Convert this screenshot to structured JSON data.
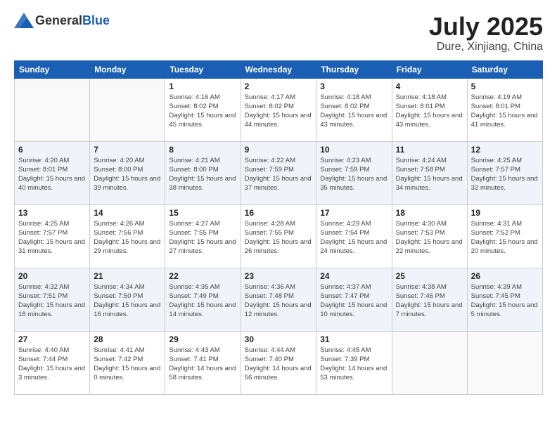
{
  "header": {
    "logo": {
      "general": "General",
      "blue": "Blue"
    },
    "title": "July 2025",
    "location": "Dure, Xinjiang, China"
  },
  "weekdays": [
    "Sunday",
    "Monday",
    "Tuesday",
    "Wednesday",
    "Thursday",
    "Friday",
    "Saturday"
  ],
  "weeks": [
    [
      {
        "day": "",
        "info": ""
      },
      {
        "day": "",
        "info": ""
      },
      {
        "day": "1",
        "info": "Sunrise: 4:16 AM\nSunset: 8:02 PM\nDaylight: 15 hours and 45 minutes."
      },
      {
        "day": "2",
        "info": "Sunrise: 4:17 AM\nSunset: 8:02 PM\nDaylight: 15 hours and 44 minutes."
      },
      {
        "day": "3",
        "info": "Sunrise: 4:18 AM\nSunset: 8:02 PM\nDaylight: 15 hours and 43 minutes."
      },
      {
        "day": "4",
        "info": "Sunrise: 4:18 AM\nSunset: 8:01 PM\nDaylight: 15 hours and 43 minutes."
      },
      {
        "day": "5",
        "info": "Sunrise: 4:19 AM\nSunset: 8:01 PM\nDaylight: 15 hours and 41 minutes."
      }
    ],
    [
      {
        "day": "6",
        "info": "Sunrise: 4:20 AM\nSunset: 8:01 PM\nDaylight: 15 hours and 40 minutes."
      },
      {
        "day": "7",
        "info": "Sunrise: 4:20 AM\nSunset: 8:00 PM\nDaylight: 15 hours and 39 minutes."
      },
      {
        "day": "8",
        "info": "Sunrise: 4:21 AM\nSunset: 8:00 PM\nDaylight: 15 hours and 38 minutes."
      },
      {
        "day": "9",
        "info": "Sunrise: 4:22 AM\nSunset: 7:59 PM\nDaylight: 15 hours and 37 minutes."
      },
      {
        "day": "10",
        "info": "Sunrise: 4:23 AM\nSunset: 7:59 PM\nDaylight: 15 hours and 35 minutes."
      },
      {
        "day": "11",
        "info": "Sunrise: 4:24 AM\nSunset: 7:58 PM\nDaylight: 15 hours and 34 minutes."
      },
      {
        "day": "12",
        "info": "Sunrise: 4:25 AM\nSunset: 7:57 PM\nDaylight: 15 hours and 32 minutes."
      }
    ],
    [
      {
        "day": "13",
        "info": "Sunrise: 4:25 AM\nSunset: 7:57 PM\nDaylight: 15 hours and 31 minutes."
      },
      {
        "day": "14",
        "info": "Sunrise: 4:26 AM\nSunset: 7:56 PM\nDaylight: 15 hours and 29 minutes."
      },
      {
        "day": "15",
        "info": "Sunrise: 4:27 AM\nSunset: 7:55 PM\nDaylight: 15 hours and 27 minutes."
      },
      {
        "day": "16",
        "info": "Sunrise: 4:28 AM\nSunset: 7:55 PM\nDaylight: 15 hours and 26 minutes."
      },
      {
        "day": "17",
        "info": "Sunrise: 4:29 AM\nSunset: 7:54 PM\nDaylight: 15 hours and 24 minutes."
      },
      {
        "day": "18",
        "info": "Sunrise: 4:30 AM\nSunset: 7:53 PM\nDaylight: 15 hours and 22 minutes."
      },
      {
        "day": "19",
        "info": "Sunrise: 4:31 AM\nSunset: 7:52 PM\nDaylight: 15 hours and 20 minutes."
      }
    ],
    [
      {
        "day": "20",
        "info": "Sunrise: 4:32 AM\nSunset: 7:51 PM\nDaylight: 15 hours and 18 minutes."
      },
      {
        "day": "21",
        "info": "Sunrise: 4:34 AM\nSunset: 7:50 PM\nDaylight: 15 hours and 16 minutes."
      },
      {
        "day": "22",
        "info": "Sunrise: 4:35 AM\nSunset: 7:49 PM\nDaylight: 15 hours and 14 minutes."
      },
      {
        "day": "23",
        "info": "Sunrise: 4:36 AM\nSunset: 7:48 PM\nDaylight: 15 hours and 12 minutes."
      },
      {
        "day": "24",
        "info": "Sunrise: 4:37 AM\nSunset: 7:47 PM\nDaylight: 15 hours and 10 minutes."
      },
      {
        "day": "25",
        "info": "Sunrise: 4:38 AM\nSunset: 7:46 PM\nDaylight: 15 hours and 7 minutes."
      },
      {
        "day": "26",
        "info": "Sunrise: 4:39 AM\nSunset: 7:45 PM\nDaylight: 15 hours and 5 minutes."
      }
    ],
    [
      {
        "day": "27",
        "info": "Sunrise: 4:40 AM\nSunset: 7:44 PM\nDaylight: 15 hours and 3 minutes."
      },
      {
        "day": "28",
        "info": "Sunrise: 4:41 AM\nSunset: 7:42 PM\nDaylight: 15 hours and 0 minutes."
      },
      {
        "day": "29",
        "info": "Sunrise: 4:43 AM\nSunset: 7:41 PM\nDaylight: 14 hours and 58 minutes."
      },
      {
        "day": "30",
        "info": "Sunrise: 4:44 AM\nSunset: 7:40 PM\nDaylight: 14 hours and 56 minutes."
      },
      {
        "day": "31",
        "info": "Sunrise: 4:45 AM\nSunset: 7:39 PM\nDaylight: 14 hours and 53 minutes."
      },
      {
        "day": "",
        "info": ""
      },
      {
        "day": "",
        "info": ""
      }
    ]
  ]
}
